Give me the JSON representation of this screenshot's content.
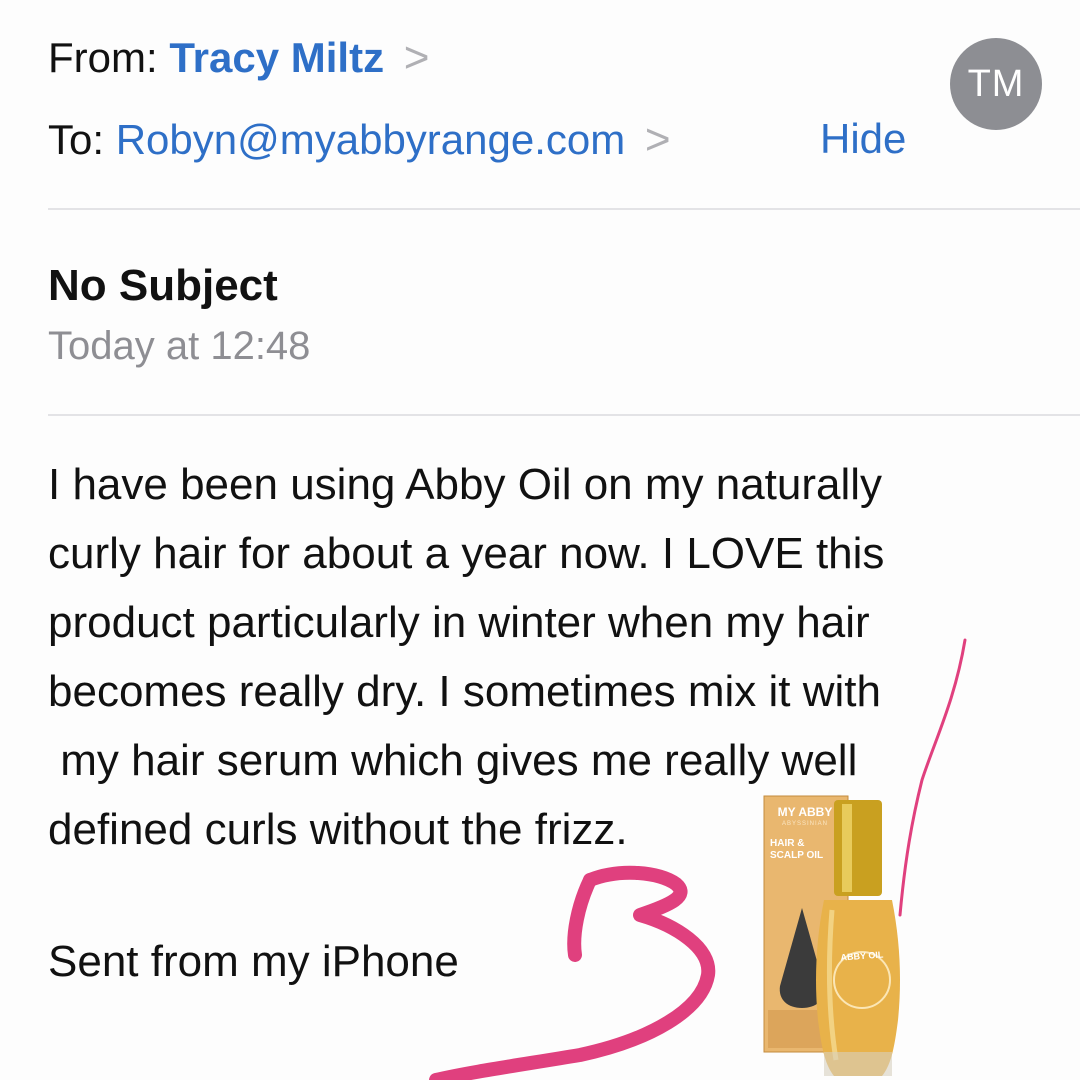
{
  "header": {
    "from_label": "From:",
    "from_name": "Tracy Miltz",
    "to_label": "To:",
    "to_address": "Robyn@myabbyrange.com",
    "chevron_glyph": ">",
    "hide_label": "Hide",
    "avatar_initials": "TM"
  },
  "message": {
    "subject": "No Subject",
    "date": "Today at 12:48",
    "body_lines": [
      "I have been using Abby Oil on my naturally",
      "curly hair for about a year now. I LOVE this",
      "product particularly in winter when my hair",
      "becomes really dry. I sometimes mix it with",
      " my hair serum which gives me really well",
      "defined curls without the frizz."
    ],
    "signature": "Sent from my iPhone"
  },
  "product": {
    "brand": "MY ABBY",
    "subbrand": "ABYSSINIAN",
    "name": "HAIR & SCALP OIL",
    "bottle_label": "ABBY OIL"
  },
  "colors": {
    "link_blue": "#2e6fc7",
    "avatar_gray": "#8d8e93",
    "muted_gray": "#8e8e93",
    "scribble_pink": "#e0407e"
  }
}
